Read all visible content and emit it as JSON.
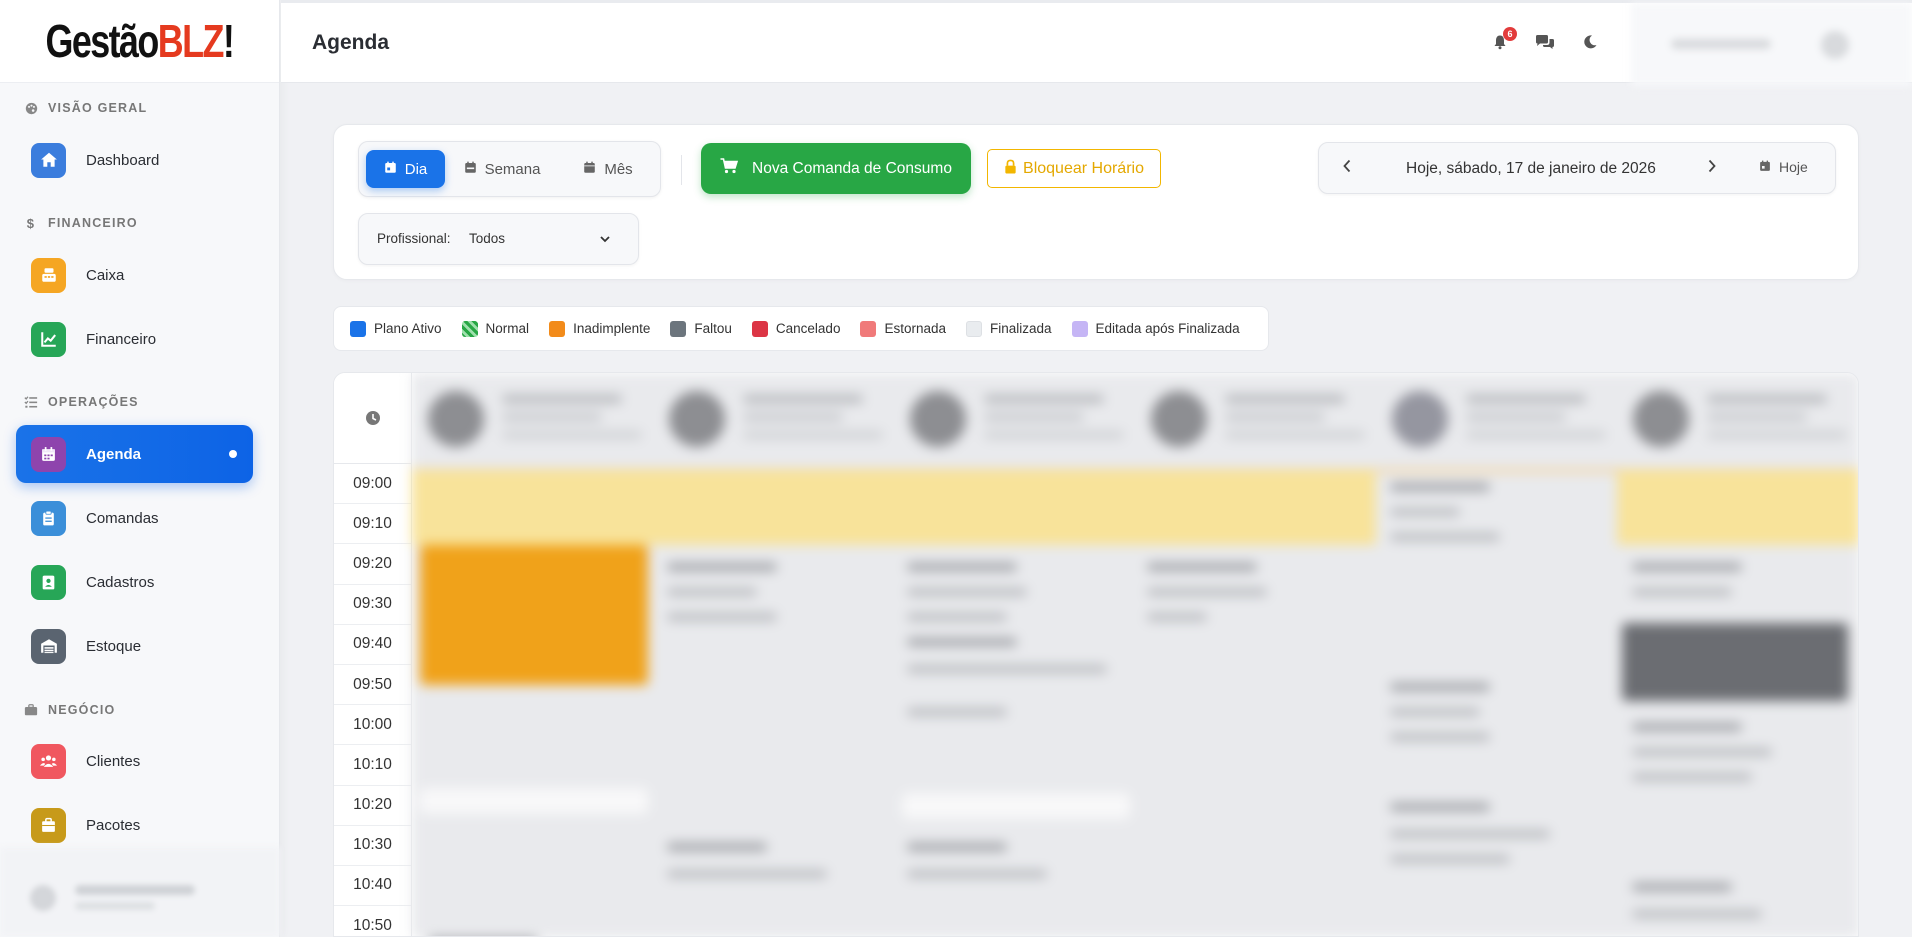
{
  "logo": {
    "part1": "Gestão",
    "part2": "BLZ",
    "part3": "!"
  },
  "sidebar": {
    "sections": [
      {
        "label": "VISÃO GERAL",
        "icon": "palette-icon"
      },
      {
        "label": "FINANCEIRO",
        "icon": "dollar-icon"
      },
      {
        "label": "OPERAÇÕES",
        "icon": "list-check-icon"
      },
      {
        "label": "NEGÓCIO",
        "icon": "briefcase-icon"
      }
    ],
    "items": [
      {
        "label": "Dashboard",
        "icon": "home-icon",
        "color": "#3b7ddd"
      },
      {
        "label": "Caixa",
        "icon": "cash-register-icon",
        "color": "#f5a623"
      },
      {
        "label": "Financeiro",
        "icon": "chart-line-icon",
        "color": "#27a657"
      },
      {
        "label": "Agenda",
        "icon": "calendar-icon",
        "color": "#8e44ad",
        "active": true
      },
      {
        "label": "Comandas",
        "icon": "clipboard-icon",
        "color": "#3b8fd9"
      },
      {
        "label": "Cadastros",
        "icon": "address-book-icon",
        "color": "#27a657"
      },
      {
        "label": "Estoque",
        "icon": "warehouse-icon",
        "color": "#5a6470"
      },
      {
        "label": "Clientes",
        "icon": "users-icon",
        "color": "#f0575f"
      },
      {
        "label": "Pacotes",
        "icon": "box-icon",
        "color": "#c79a1a"
      }
    ]
  },
  "header": {
    "title": "Agenda",
    "notifications_count": "6"
  },
  "toolbar": {
    "views": [
      {
        "label": "Dia",
        "active": true
      },
      {
        "label": "Semana",
        "active": false
      },
      {
        "label": "Mês",
        "active": false
      }
    ],
    "new_order_label": "Nova Comanda de Consumo",
    "block_label": "Bloquear Horário",
    "date_label": "Hoje, sábado, 17 de janeiro de 2026",
    "today_label": "Hoje",
    "professional_label": "Profissional:",
    "professional_value": "Todos"
  },
  "legend": [
    {
      "label": "Plano Ativo",
      "color": "#1a73e8"
    },
    {
      "label": "Normal",
      "color": "#28a745",
      "pattern": "striped"
    },
    {
      "label": "Inadimplente",
      "color": "#f28b1a"
    },
    {
      "label": "Faltou",
      "color": "#6c757d"
    },
    {
      "label": "Cancelado",
      "color": "#dc3545"
    },
    {
      "label": "Estornada",
      "color": "#f07a7a"
    },
    {
      "label": "Finalizada",
      "color": "#e9ecef"
    },
    {
      "label": "Editada após Finalizada",
      "color": "#c5b5f5"
    }
  ],
  "calendar": {
    "time_slots": [
      "09:00",
      "09:10",
      "09:20",
      "09:30",
      "09:40",
      "09:50",
      "10:00",
      "10:10",
      "10:20",
      "10:30",
      "10:40",
      "10:50"
    ]
  },
  "colors": {
    "primary": "#1a73e8",
    "success": "#28a745",
    "warning": "#f2b600"
  }
}
